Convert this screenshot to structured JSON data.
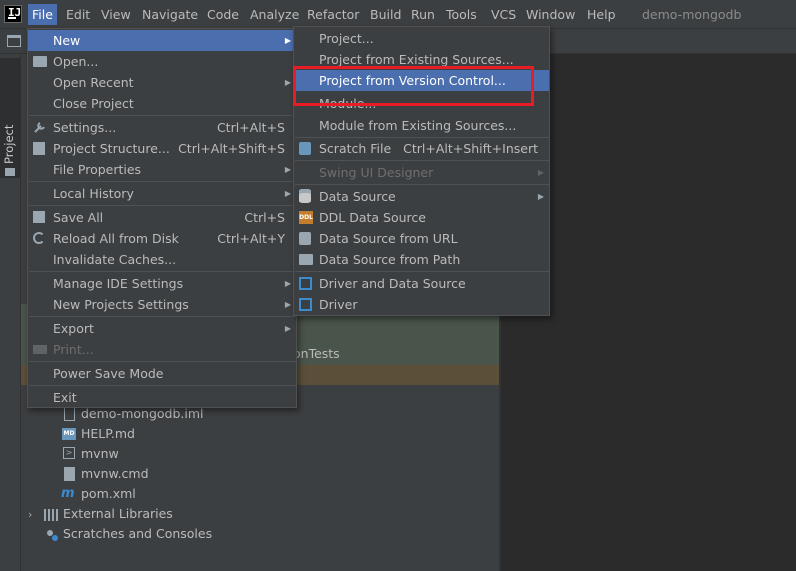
{
  "menubar": {
    "items": [
      "File",
      "Edit",
      "View",
      "Navigate",
      "Code",
      "Analyze",
      "Refactor",
      "Build",
      "Run",
      "Tools",
      "VCS",
      "Window",
      "Help"
    ],
    "project_title": "demo-mongodb"
  },
  "tool_window": {
    "project_label": "Project"
  },
  "file_menu": {
    "items": [
      {
        "label": "New",
        "shortcut": ""
      },
      {
        "label": "Open...",
        "shortcut": ""
      },
      {
        "label": "Open Recent",
        "shortcut": ""
      },
      {
        "label": "Close Project",
        "shortcut": ""
      },
      {
        "label": "Settings...",
        "shortcut": "Ctrl+Alt+S"
      },
      {
        "label": "Project Structure...",
        "shortcut": "Ctrl+Alt+Shift+S"
      },
      {
        "label": "File Properties",
        "shortcut": ""
      },
      {
        "label": "Local History",
        "shortcut": ""
      },
      {
        "label": "Save All",
        "shortcut": "Ctrl+S"
      },
      {
        "label": "Reload All from Disk",
        "shortcut": "Ctrl+Alt+Y"
      },
      {
        "label": "Invalidate Caches...",
        "shortcut": ""
      },
      {
        "label": "Manage IDE Settings",
        "shortcut": ""
      },
      {
        "label": "New Projects Settings",
        "shortcut": ""
      },
      {
        "label": "Export",
        "shortcut": ""
      },
      {
        "label": "Print...",
        "shortcut": ""
      },
      {
        "label": "Power Save Mode",
        "shortcut": ""
      },
      {
        "label": "Exit",
        "shortcut": ""
      }
    ]
  },
  "new_submenu": {
    "items": [
      {
        "label": "Project...",
        "shortcut": ""
      },
      {
        "label": "Project from Existing Sources...",
        "shortcut": ""
      },
      {
        "label": "Project from Version Control...",
        "shortcut": ""
      },
      {
        "label": "Module...",
        "shortcut": ""
      },
      {
        "label": "Module from Existing Sources...",
        "shortcut": ""
      },
      {
        "label": "Scratch File",
        "shortcut": "Ctrl+Alt+Shift+Insert"
      },
      {
        "label": "Swing UI Designer",
        "shortcut": ""
      },
      {
        "label": "Data Source",
        "shortcut": ""
      },
      {
        "label": "DDL Data Source",
        "shortcut": ""
      },
      {
        "label": "Data Source from URL",
        "shortcut": ""
      },
      {
        "label": "Data Source from Path",
        "shortcut": ""
      },
      {
        "label": "Driver and Data Source",
        "shortcut": ""
      },
      {
        "label": "Driver",
        "shortcut": ""
      }
    ]
  },
  "project_tree": {
    "partial_label": "onTests",
    "files": [
      "demo-mongodb.iml",
      "HELP.md",
      "mvnw",
      "mvnw.cmd",
      "pom.xml"
    ],
    "external_libraries": "External Libraries",
    "scratches": "Scratches and Consoles"
  },
  "colors": {
    "menu_bg": "#3c3f41",
    "selection": "#4b6eaf",
    "highlight_box": "#e81c24",
    "editor_bg": "#2b2b2b"
  }
}
